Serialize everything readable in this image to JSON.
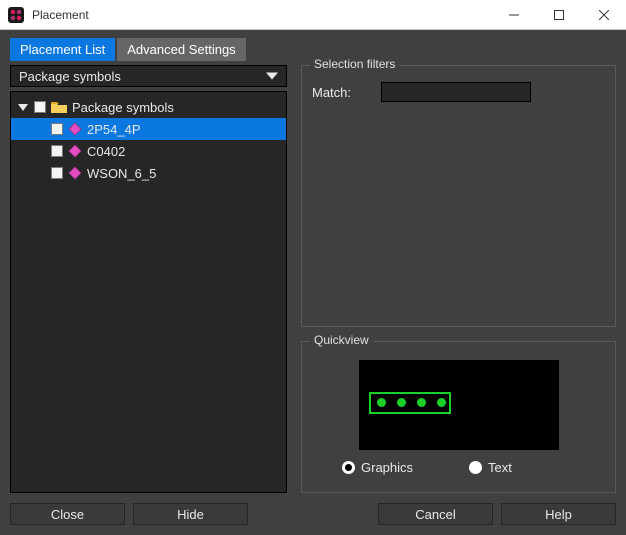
{
  "window": {
    "title": "Placement"
  },
  "tabs": {
    "placement_list": "Placement List",
    "advanced_settings": "Advanced Settings"
  },
  "dropdown": {
    "selected": "Package symbols"
  },
  "tree": {
    "root_label": "Package symbols",
    "items": [
      {
        "label": "2P54_4P"
      },
      {
        "label": "C0402"
      },
      {
        "label": "WSON_6_5"
      }
    ]
  },
  "selection_filters": {
    "legend": "Selection filters",
    "match_label": "Match:",
    "match_value": ""
  },
  "quickview": {
    "legend": "Quickview",
    "radio_graphics": "Graphics",
    "radio_text": "Text"
  },
  "buttons": {
    "close": "Close",
    "hide": "Hide",
    "cancel": "Cancel",
    "help": "Help"
  }
}
